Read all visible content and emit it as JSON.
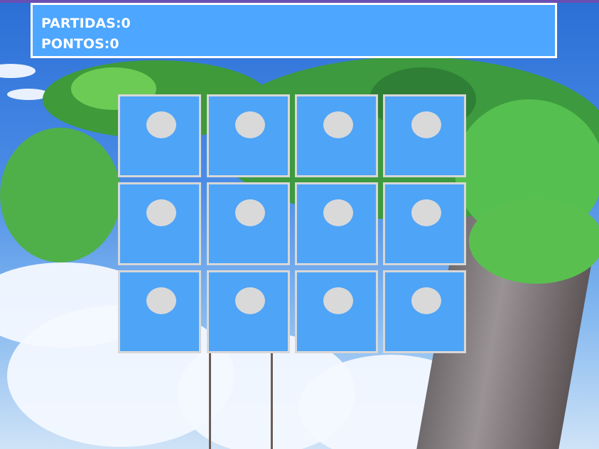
{
  "scoreboard": {
    "matches_label": "PARTIDAS:0",
    "points_label": "PONTOS:0"
  },
  "board": {
    "rows": 3,
    "columns": 4,
    "cards": [
      {
        "state": "face-down"
      },
      {
        "state": "face-down"
      },
      {
        "state": "face-down"
      },
      {
        "state": "face-down"
      },
      {
        "state": "face-down"
      },
      {
        "state": "face-down"
      },
      {
        "state": "face-down"
      },
      {
        "state": "face-down"
      },
      {
        "state": "face-down"
      },
      {
        "state": "face-down"
      },
      {
        "state": "face-down"
      },
      {
        "state": "face-down"
      }
    ]
  },
  "colors": {
    "panel": "#4da6ff",
    "card": "#4ea4f7",
    "card_border": "#d7d7d7",
    "card_dot": "#d9d9d9"
  }
}
